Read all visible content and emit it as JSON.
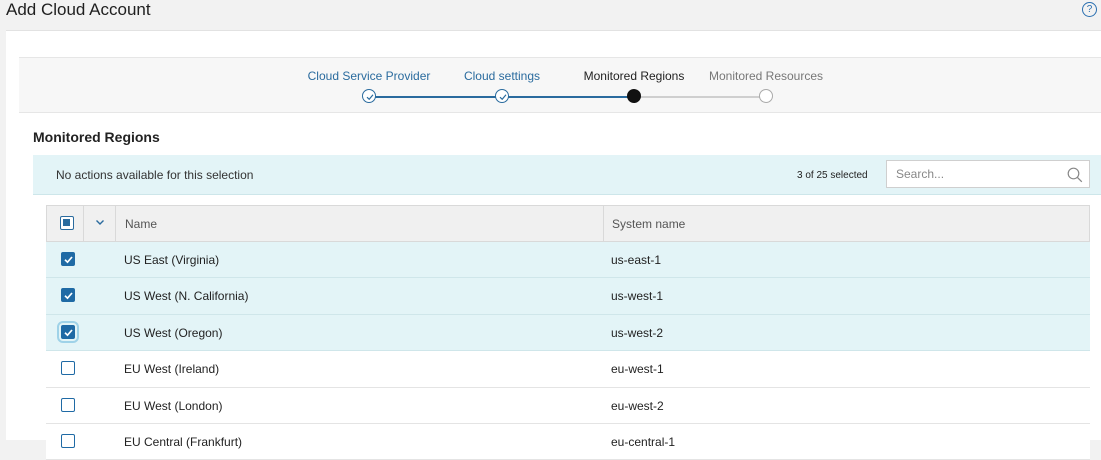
{
  "header": {
    "title": "Add Cloud Account",
    "help_icon": "?"
  },
  "wizard": {
    "steps": [
      {
        "label": "Cloud Service Provider",
        "state": "done"
      },
      {
        "label": "Cloud settings",
        "state": "done"
      },
      {
        "label": "Monitored Regions",
        "state": "current"
      },
      {
        "label": "Monitored Resources",
        "state": "future"
      }
    ]
  },
  "section": {
    "title": "Monitored Regions"
  },
  "actions": {
    "no_actions_text": "No actions available for this selection",
    "selected_count": "3 of 25 selected",
    "search_placeholder": "Search..."
  },
  "table": {
    "columns": {
      "name": "Name",
      "system_name": "System name"
    },
    "rows": [
      {
        "name": "US East (Virginia)",
        "system_name": "us-east-1",
        "checked": true
      },
      {
        "name": "US West (N. California)",
        "system_name": "us-west-1",
        "checked": true
      },
      {
        "name": "US West (Oregon)",
        "system_name": "us-west-2",
        "checked": true
      },
      {
        "name": "EU West (Ireland)",
        "system_name": "eu-west-1",
        "checked": false
      },
      {
        "name": "EU West (London)",
        "system_name": "eu-west-2",
        "checked": false
      },
      {
        "name": "EU Central (Frankfurt)",
        "system_name": "eu-central-1",
        "checked": false
      }
    ]
  },
  "colors": {
    "accent": "#2a6b9e",
    "selection_bg": "#e3f4f7",
    "checkbox": "#1f6aa5"
  }
}
